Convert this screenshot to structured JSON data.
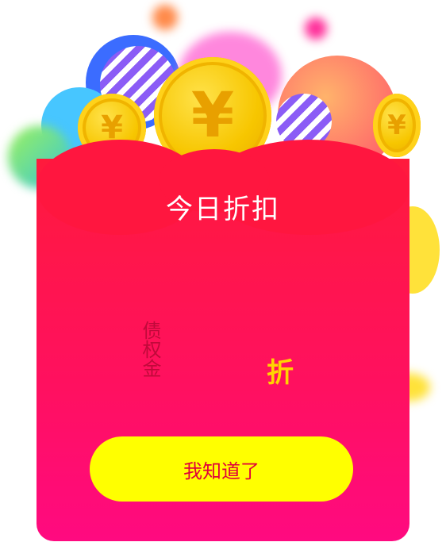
{
  "dialog": {
    "title": "今日折扣",
    "label_vertical": "债权金",
    "discount_suffix": "折",
    "confirm_button": "我知道了"
  },
  "decor": {
    "coin_symbol": "¥"
  },
  "colors": {
    "card_top": "#ff1a3c",
    "card_bottom": "#ff0a80",
    "button_bg": "#ffff00",
    "button_text": "#e0003a",
    "accent_yellow": "#ffd400"
  }
}
